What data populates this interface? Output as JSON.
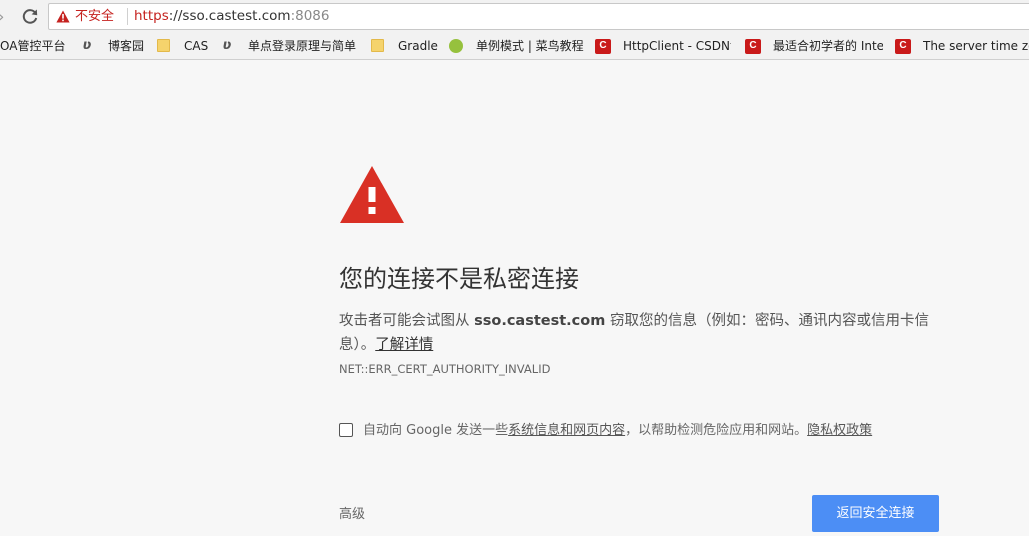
{
  "toolbar": {
    "security_label": "不安全",
    "url": {
      "scheme": "https",
      "separator": "://",
      "host": "sso.castest.com",
      "port": ":8086"
    }
  },
  "bookmarks": [
    {
      "label": "OA管控平台",
      "icon": "none"
    },
    {
      "label": "博客园",
      "icon": "cnblogs-icon"
    },
    {
      "label": "CAS",
      "icon": "folder-icon"
    },
    {
      "label": "单点登录原理与简单",
      "icon": "cnblogs-icon"
    },
    {
      "label": "Gradle",
      "icon": "folder-icon"
    },
    {
      "label": "单例模式 | 菜鸟教程",
      "icon": "runoob-icon"
    },
    {
      "label": "HttpClient - CSDN博",
      "icon": "csdn-icon"
    },
    {
      "label": "最适合初学者的 Inte",
      "icon": "csdn-icon"
    },
    {
      "label": "The server time zo",
      "icon": "csdn-icon"
    }
  ],
  "interstitial": {
    "heading": "您的连接不是私密连接",
    "explanation_prefix": "攻击者可能会试图从 ",
    "explanation_host": "sso.castest.com",
    "explanation_suffix": " 窃取您的信息（例如：密码、通讯内容或信用卡信息）。",
    "learn_more": "了解详情",
    "error_code": "NET::ERR_CERT_AUTHORITY_INVALID",
    "report_checkbox": {
      "checked": false,
      "text_prefix": "自动向 Google 发送一些",
      "link1": "系统信息和网页内容",
      "text_middle": "，以帮助检测危险应用和网站。",
      "link2": "隐私权政策"
    },
    "advanced_label": "高级",
    "back_button_label": "返回安全连接"
  },
  "colors": {
    "accent": "#4c8ef5",
    "warning": "#d93025",
    "insecure": "#c5221f",
    "background": "#f7f7f7"
  }
}
